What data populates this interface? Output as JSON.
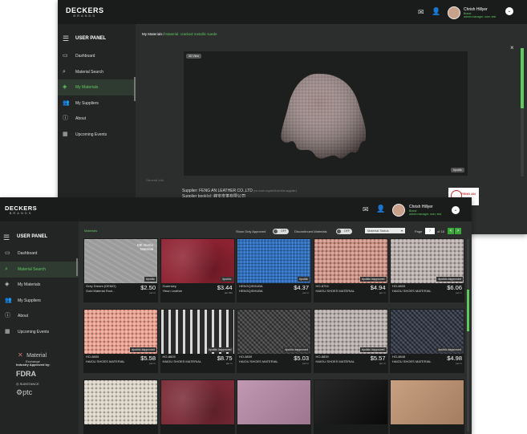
{
  "back_window": {
    "logo": "DECKERS",
    "logo_sub": "BRANDS",
    "user_name": "Chrish Hillyer",
    "user_role": "Brand",
    "user_sub": "admin manager, user, test",
    "sidebar_title": "USER PANEL",
    "nav": [
      "Dashboard",
      "Material Search",
      "My Materials",
      "My Suppliers",
      "About",
      "Upcoming Events"
    ],
    "breadcrumb_root": "My Materials",
    "breadcrumb_leaf": "Material: cracked metallic suede",
    "view_label": "3D View",
    "public_tag": "#public",
    "section_label": "General Info",
    "supplier_text": "Supplier: FENG AN LEATHER CO.,LTD",
    "supplier_note": "(no more copied from the supplier)",
    "supplier_text2": "Supplier book(s): 峰安皮革有限公司",
    "supplier_logo": "FENG AN"
  },
  "front_window": {
    "logo": "DECKERS",
    "logo_sub": "BRANDS",
    "user_name": "Chrish Hillyer",
    "user_role": "Brand",
    "user_sub": "admin manager, user, test",
    "sidebar_title": "USER PANEL",
    "nav": [
      "Dashboard",
      "Material Search",
      "My Materials",
      "My Suppliers",
      "About",
      "Upcoming Events"
    ],
    "partner_brand": "Material",
    "partner_brand_sub": "Exchange",
    "approved_by": "Industry Approved by:",
    "fdra": "FDRA",
    "substance": "SUBSTANCE",
    "ptc": "ptc",
    "section": "Materials",
    "show_approved": "Show Only Approved",
    "discontinued": "Discontinued Materials",
    "toggle_off": "OFF",
    "status_select": "Material Status",
    "page_label": "Page",
    "page_value": "7",
    "page_total": "of 18",
    "pg_prev": "<",
    "pg_next": ">",
    "cards": [
      {
        "code": "Grey Dream (DEMO)",
        "name": "Gold Material Rool...",
        "price": "$2.50",
        "unit": "per m",
        "badge": "#public",
        "color": "#9b9b9b",
        "tex": "demo",
        "demo": "ME Demo\nMaterial"
      },
      {
        "code": "Guernsey",
        "name": "Yieun Leather",
        "price": "$3.44",
        "unit": "per SM",
        "badge": "#public",
        "color": "#8e2232",
        "tex": "suede"
      },
      {
        "code": "HENGQISHUBA",
        "name": "HENGQISHUBA",
        "price": "$4.37",
        "unit": "per m",
        "badge": "#public",
        "color": "#2f6fc0",
        "tex": "mesh"
      },
      {
        "code": "HO-8704",
        "name": "HAIOU SHOES MATERIAL",
        "price": "$4.94",
        "unit": "per m",
        "badge": "#public #approved",
        "color": "#c98a7e",
        "tex": "knit"
      },
      {
        "code": "HO-8805",
        "name": "HAIOU SHOES MATERIAL",
        "price": "$6.06",
        "unit": "per m",
        "badge": "#public #approved",
        "color": "#b5aba8",
        "tex": "knit"
      },
      {
        "code": "HO-8805",
        "name": "HAIOU SHOES MATERIAL",
        "price": "$5.58",
        "unit": "per m",
        "badge": "#public #approved",
        "color": "#e89a88",
        "tex": "knit"
      },
      {
        "code": "HO-8805",
        "name": "HAIOU SHOES MATERIAL",
        "price": "$8.75",
        "unit": "per m",
        "badge": "#public #approved",
        "color": "#505050",
        "tex": "stripe"
      },
      {
        "code": "HO-8839",
        "name": "HAIOU SHOES MATERIAL",
        "price": "$5.03",
        "unit": "per m",
        "badge": "#public #approved",
        "color": "#3c3c3c",
        "tex": "weave"
      },
      {
        "code": "HO-8839",
        "name": "HAIOU SHOES MATERIAL",
        "price": "$5.57",
        "unit": "per m",
        "badge": "#public #approved",
        "color": "#b0a8a6",
        "tex": "knit"
      },
      {
        "code": "HO-8848",
        "name": "HAIOU SHOES MATERIAL",
        "price": "$4.98",
        "unit": "per m",
        "badge": "#public #approved",
        "color": "#2e3444",
        "tex": "weave"
      },
      {
        "code": "",
        "name": "",
        "price": "",
        "unit": "",
        "badge": "",
        "color": "#d8d2c3",
        "tex": "knit"
      },
      {
        "code": "",
        "name": "",
        "price": "",
        "unit": "",
        "badge": "",
        "color": "#7a2a36",
        "tex": "suede"
      },
      {
        "code": "",
        "name": "",
        "price": "",
        "unit": "",
        "badge": "",
        "color": "#b88aa8",
        "tex": "plain"
      },
      {
        "code": "",
        "name": "",
        "price": "",
        "unit": "",
        "badge": "",
        "color": "#0c0c0c",
        "tex": "plain"
      },
      {
        "code": "",
        "name": "",
        "price": "",
        "unit": "",
        "badge": "",
        "color": "#c09270",
        "tex": "plain"
      }
    ]
  },
  "colors": {
    "accent": "#5fc95f",
    "bg": "#2b2e2d",
    "topbar": "#1a1c1c"
  },
  "icons": [
    "mail-icon",
    "add-user-icon",
    "menu-icon",
    "monitor-icon",
    "search-icon",
    "layers-icon",
    "users-icon",
    "info-icon",
    "calendar-icon",
    "close-icon",
    "chevron-down-icon"
  ]
}
